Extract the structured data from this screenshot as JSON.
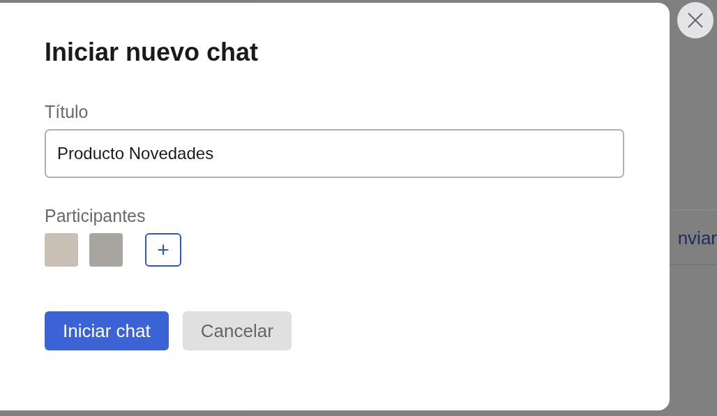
{
  "background": {
    "link": "nviar"
  },
  "dialog": {
    "title": "Iniciar nuevo chat",
    "title_field": {
      "label": "Título",
      "value": "Producto Novedades"
    },
    "participants": {
      "label": "Participantes",
      "items": [
        {
          "kind": "photo"
        },
        {
          "kind": "photo"
        }
      ],
      "add_button": "+"
    },
    "buttons": [
      {
        "label": "Iniciar chat",
        "kind": "primary"
      },
      {
        "label": "Cancelar",
        "kind": "secondary"
      }
    ]
  }
}
